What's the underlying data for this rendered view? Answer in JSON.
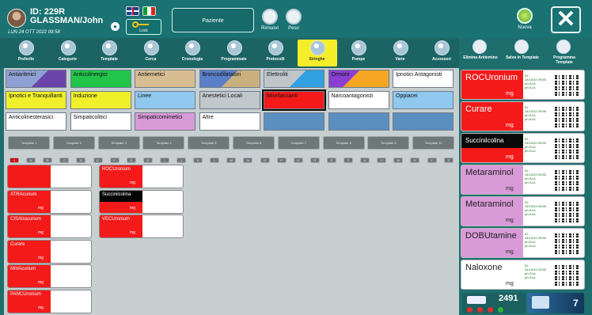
{
  "patient": {
    "id": "ID: 229R",
    "name": "GLASSMAN/John",
    "date": "LUN 24 OTT 2022 09:58"
  },
  "header": {
    "key_label": "Lock",
    "paziente_label": "Paziente",
    "rimuovi_label": "Rimuovi",
    "peso_label": "Peso",
    "nuova_label": "Nuova",
    "close_symbol": "✕"
  },
  "toolbar": [
    {
      "label": "Preferite",
      "icon": "star-icon"
    },
    {
      "label": "Categorie",
      "icon": "tags-icon"
    },
    {
      "label": "Template",
      "icon": "template-icon"
    },
    {
      "label": "Cerca",
      "icon": "search-icon"
    },
    {
      "label": "Cronologia",
      "icon": "history-icon"
    },
    {
      "label": "Programmate",
      "icon": "calendar-icon"
    },
    {
      "label": "Protocolli",
      "icon": "protocol-icon"
    },
    {
      "label": "Siringhe",
      "icon": "syringe-icon"
    },
    {
      "label": "Pompe",
      "icon": "pump-icon"
    },
    {
      "label": "Varie",
      "icon": "misc-icon"
    },
    {
      "label": "Accessori",
      "icon": "accessories-icon"
    }
  ],
  "right_toolbar": [
    {
      "label": "Elimina Antiemino",
      "icon": "trash-icon"
    },
    {
      "label": "Salva in Template",
      "icon": "save-template-icon"
    },
    {
      "label": "Programma Template",
      "icon": "program-template-icon"
    }
  ],
  "categories": [
    {
      "label": "Antiaritmici",
      "bg": "linear-gradient(135deg,#8ea0d4 0 55%,#6a44a8 55%)"
    },
    {
      "label": "Anticolinergici",
      "bg": "#22c44a"
    },
    {
      "label": "Antiemetici",
      "bg": "#d8bd92"
    },
    {
      "label": "Broncodilatatori",
      "bg": "linear-gradient(135deg,#5a7fc8 0 50%,#c9b07e 50%)"
    },
    {
      "label": "Elettroliti",
      "bg": "linear-gradient(135deg,#bfc6ca 0 55%,#31a0e0 55%)"
    },
    {
      "label": "Ormoni",
      "bg": "linear-gradient(135deg,#8a3fd1 0 40%,#f5a623 40%)"
    },
    {
      "label": "Ipnotici Antagonisti",
      "bg": "#ffffff"
    },
    {
      "label": "Ipnotici e Tranquillanti",
      "bg": "#f0f02a"
    },
    {
      "label": "Induzione",
      "bg": "#f0f02a"
    },
    {
      "label": "Linee",
      "bg": "#8fc9f0"
    },
    {
      "label": "Anestetici Locali",
      "bg": "#c0c8cc"
    },
    {
      "label": "Miorilassanti",
      "bg": "#f41a1a"
    },
    {
      "label": "Narcoantagonisti",
      "bg": "#ffffff"
    },
    {
      "label": "Oppiacei",
      "bg": "#8fc9f0"
    },
    {
      "label": "Anticolinesterasici",
      "bg": "#ffffff"
    },
    {
      "label": "Simpaticolitici",
      "bg": "#ffffff"
    },
    {
      "label": "Simpaticomimetici",
      "bg": "#d99ad8"
    },
    {
      "label": "Altre",
      "bg": "#ffffff"
    },
    {
      "label": "",
      "bg": "#5b8fc0"
    },
    {
      "label": "",
      "bg": "#5b8fc0"
    },
    {
      "label": "",
      "bg": "#5b8fc0"
    }
  ],
  "templates": [
    "Template 1",
    "Template 2",
    "Template 3",
    "Template 4",
    "Template 5",
    "Template 6",
    "Template 7",
    "Template 8",
    "Template 9",
    "Template 10"
  ],
  "letters": [
    "0",
    "A",
    "B",
    "C",
    "D",
    "E",
    "F",
    "G",
    "H",
    "I",
    "J",
    "K",
    "L",
    "M",
    "N",
    "O",
    "P",
    "Q",
    "R",
    "S",
    "T",
    "U",
    "V",
    "W",
    "X",
    "Y",
    "Z"
  ],
  "drugs_col1": [
    {
      "name": "",
      "unit": ""
    },
    {
      "name": "ATRAcurium",
      "unit": "mg"
    },
    {
      "name": "CISAtracurium",
      "unit": "mg"
    },
    {
      "name": "Curare",
      "unit": "mg"
    },
    {
      "name": "MIVAcurium",
      "unit": "mg"
    },
    {
      "name": "PANCUronium",
      "unit": "mg"
    }
  ],
  "drugs_col2": [
    {
      "name": "ROCUronium",
      "unit": "mg",
      "black": false
    },
    {
      "name": "Succinilcolina",
      "unit": "mg",
      "black": true
    },
    {
      "name": "VECUronium",
      "unit": "mg",
      "black": false
    }
  ],
  "labels": [
    {
      "name": "ROCUronium",
      "unit": "mg",
      "color": "#f41a1a",
      "black": false,
      "meta": [
        "ID:",
        "24/10/22 09:58",
        "ph:GLA",
        "ph:GLA"
      ]
    },
    {
      "name": "Curare",
      "unit": "mg",
      "color": "#f41a1a",
      "black": false,
      "meta": [
        "ID:",
        "24/10/22 09:58",
        "ph:GLA",
        "ph:GLA"
      ]
    },
    {
      "name": "Succinilcolina",
      "unit": "mg",
      "color": "#f41a1a",
      "black": true,
      "meta": [
        "ID:",
        "24/10/22 09:58",
        "ph:GLA",
        "ph:GLA"
      ]
    },
    {
      "name": "Metaraminol",
      "unit": "mg",
      "color": "#d99ad8",
      "black": false,
      "meta": [
        "ID:",
        "24/10/22 09:58",
        "ph:GLA",
        "ph:GLA"
      ]
    },
    {
      "name": "Metaraminol",
      "unit": "mg",
      "color": "#d99ad8",
      "black": false,
      "meta": [
        "ID:",
        "24/10/22 09:58",
        "ph:GLA",
        "ph:GLA"
      ]
    },
    {
      "name": "DOBUtamine",
      "unit": "mg",
      "color": "#d99ad8",
      "black": false,
      "meta": [
        "ID:",
        "24/10/22 09:58",
        "ph:GLA",
        "ph:GLA"
      ]
    },
    {
      "name": "Naloxone",
      "unit": "mg",
      "color": "#ffffff",
      "black": false,
      "meta": [
        "ID:",
        "24/10/22 09:58",
        "ph:GLA",
        "ph:GLA"
      ]
    }
  ],
  "printer": {
    "count": "2491",
    "queue": "7"
  }
}
